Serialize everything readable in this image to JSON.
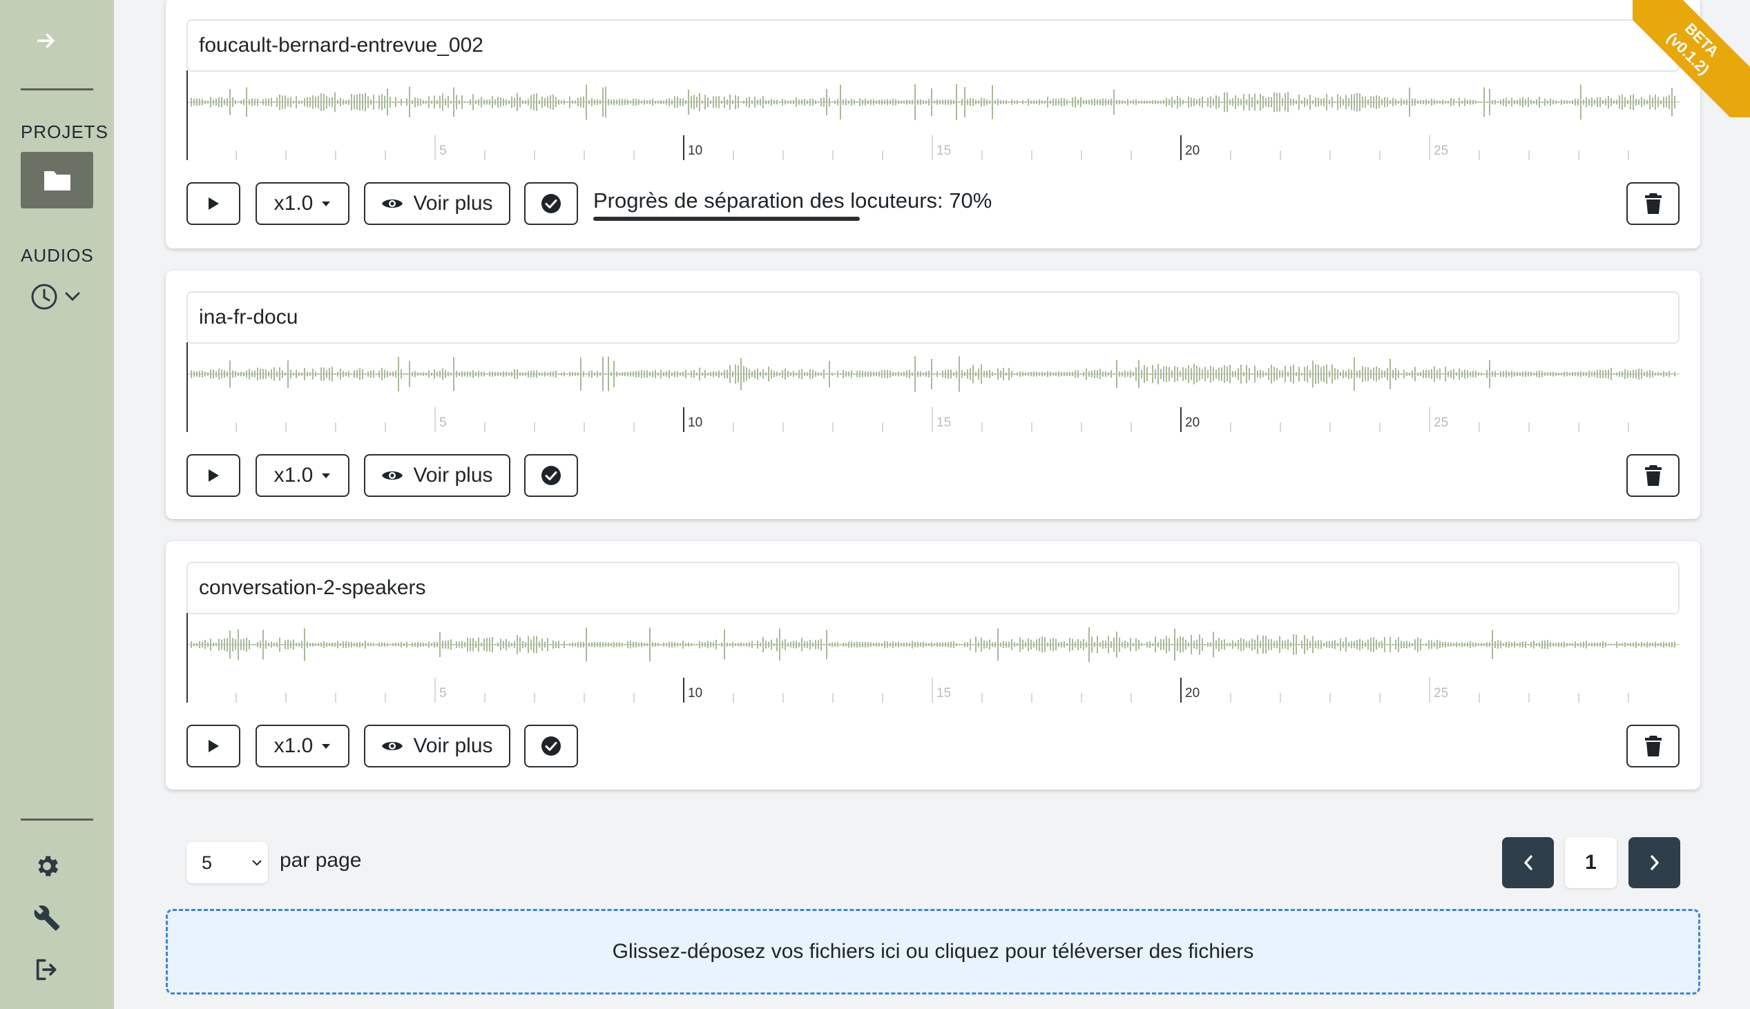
{
  "sidebar": {
    "projects_label": "PROJETS",
    "audios_label": "AUDIOS"
  },
  "audios": [
    {
      "title": "foucault-bernard-entrevue_002",
      "speed": "x1.0",
      "more_label": "Voir plus",
      "progress_text": "Progrès de séparation des locuteurs: 70%",
      "progress": 0.7,
      "ticks": [
        "5",
        "10",
        "15",
        "20",
        "25"
      ]
    },
    {
      "title": "ina-fr-docu",
      "speed": "x1.0",
      "more_label": "Voir plus",
      "ticks": [
        "5",
        "10",
        "15",
        "20",
        "25"
      ]
    },
    {
      "title": "conversation-2-speakers",
      "speed": "x1.0",
      "more_label": "Voir plus",
      "ticks": [
        "5",
        "10",
        "15",
        "20",
        "25"
      ]
    }
  ],
  "pagination": {
    "per_page_value": "5",
    "per_page_label": "par page",
    "current_page": "1"
  },
  "dropzone_text": "Glissez-déposez vos fichiers ici ou cliquez pour téléverser des fichiers",
  "beta": {
    "line1": "BETA",
    "line2": "(v0.1.2)"
  },
  "colors": {
    "sidebar": "#c3ceb7",
    "waveform": "#a9b99a",
    "accent": "#2e3e4b",
    "ribbon": "#e8a80c",
    "dropzone_border": "#3a86d4"
  }
}
